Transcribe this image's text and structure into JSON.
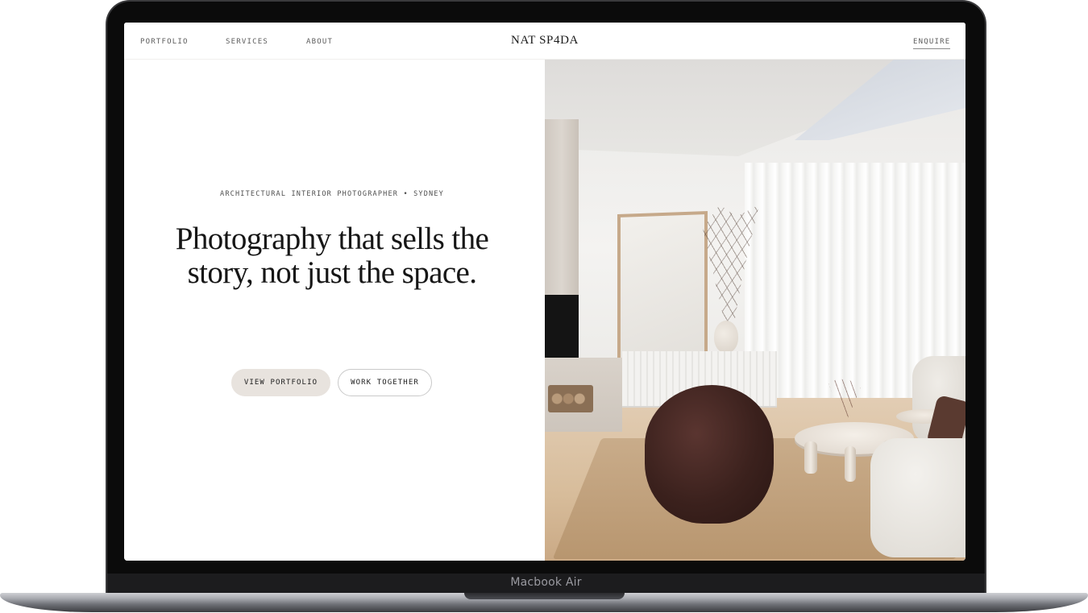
{
  "device": {
    "label": "Macbook Air"
  },
  "site": {
    "nav": {
      "portfolio": "PORTFOLIO",
      "services": "SERVICES",
      "about": "ABOUT",
      "brand": "NAT SP4DA",
      "enquire": "ENQUIRE"
    },
    "hero": {
      "eyebrow": "ARCHITECTURAL INTERIOR PHOTOGRAPHER • SYDNEY",
      "headline": "Photography that sells the story, not just the space.",
      "buttons": {
        "primary": "VIEW PORTFOLIO",
        "secondary": "WORK TOGETHER"
      }
    }
  },
  "colors": {
    "button_primary_bg": "#e8e3de",
    "text_dark": "#161616",
    "frame": "#0b0b0b"
  }
}
